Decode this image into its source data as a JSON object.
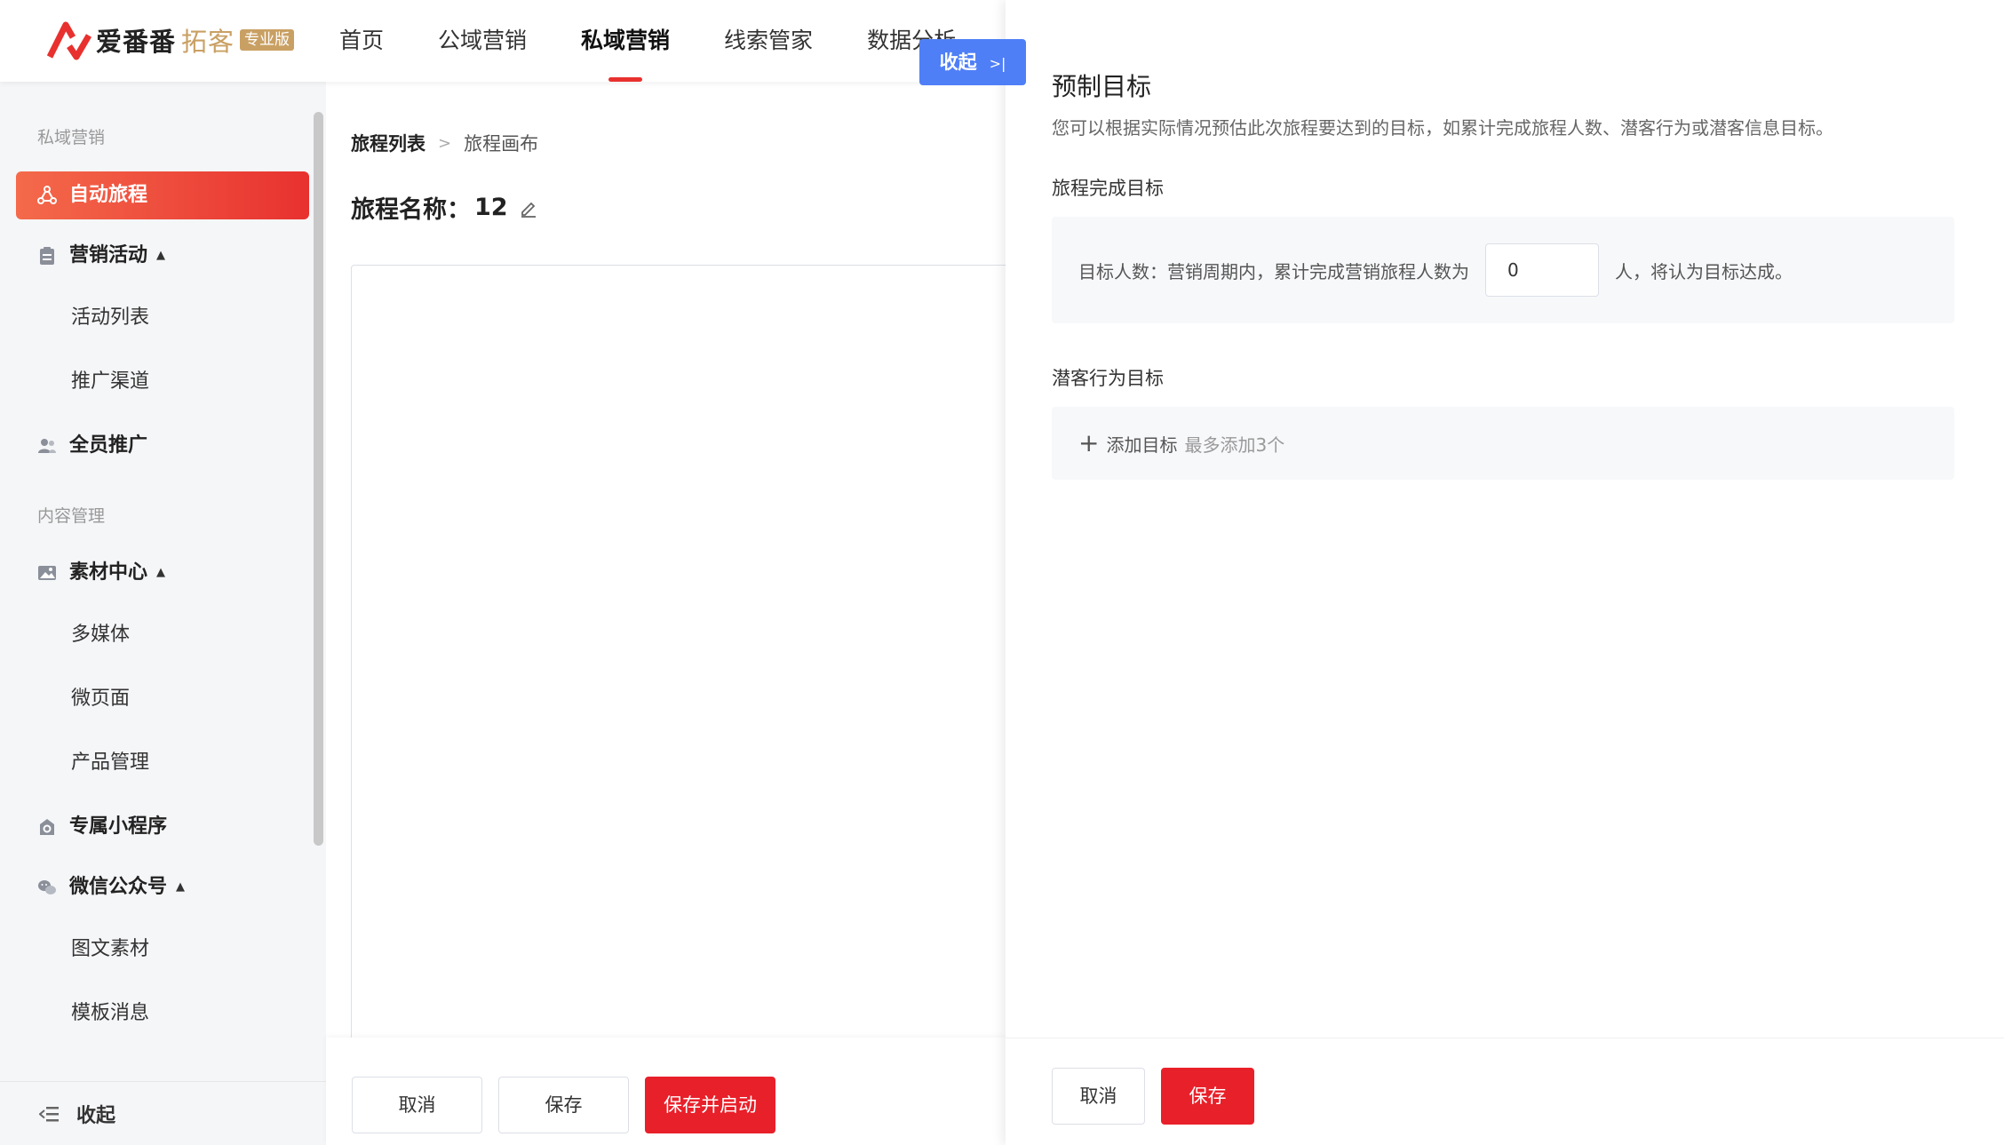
{
  "header": {
    "logo_text": "爱番番",
    "logo_sub": "拓客",
    "logo_badge": "专业版",
    "nav": [
      "首页",
      "公域营销",
      "私域营销",
      "线索管家",
      "数据分析"
    ],
    "active_nav": "私域营销"
  },
  "sidebar": {
    "group1": "私域营销",
    "auto_journey": "自动旅程",
    "marketing_activity": "营销活动",
    "activity_list": "活动列表",
    "promo_channel": "推广渠道",
    "all_staff": "全员推广",
    "group2": "内容管理",
    "material_center": "素材中心",
    "multimedia": "多媒体",
    "micro_page": "微页面",
    "product_mgmt": "产品管理",
    "mini_program": "专属小程序",
    "wechat_official": "微信公众号",
    "image_text": "图文素材",
    "template_msg": "模板消息",
    "collapse": "收起"
  },
  "main": {
    "breadcrumb_first": "旅程列表",
    "breadcrumb_current": "旅程画布",
    "title_label": "旅程名称：",
    "title_value": "12",
    "cancel": "取消",
    "save": "保存",
    "save_start": "保存并启动"
  },
  "panel": {
    "toggle": "收起",
    "title": "预制目标",
    "desc": "您可以根据实际情况预估此次旅程要达到的目标，如累计完成旅程人数、潜客行为或潜客信息目标。",
    "complete_label": "旅程完成目标",
    "goal_prefix": "目标人数：营销周期内，累计完成营销旅程人数为",
    "goal_value": "0",
    "goal_suffix": "人，将认为目标达成。",
    "behavior_label": "潜客行为目标",
    "add_goal": "添加目标",
    "add_hint": "最多添加3个",
    "cancel": "取消",
    "save": "保存"
  },
  "colors": {
    "brand_red": "#e8312f",
    "toggle_blue": "#4f7ff7",
    "gold": "#c9a063"
  }
}
